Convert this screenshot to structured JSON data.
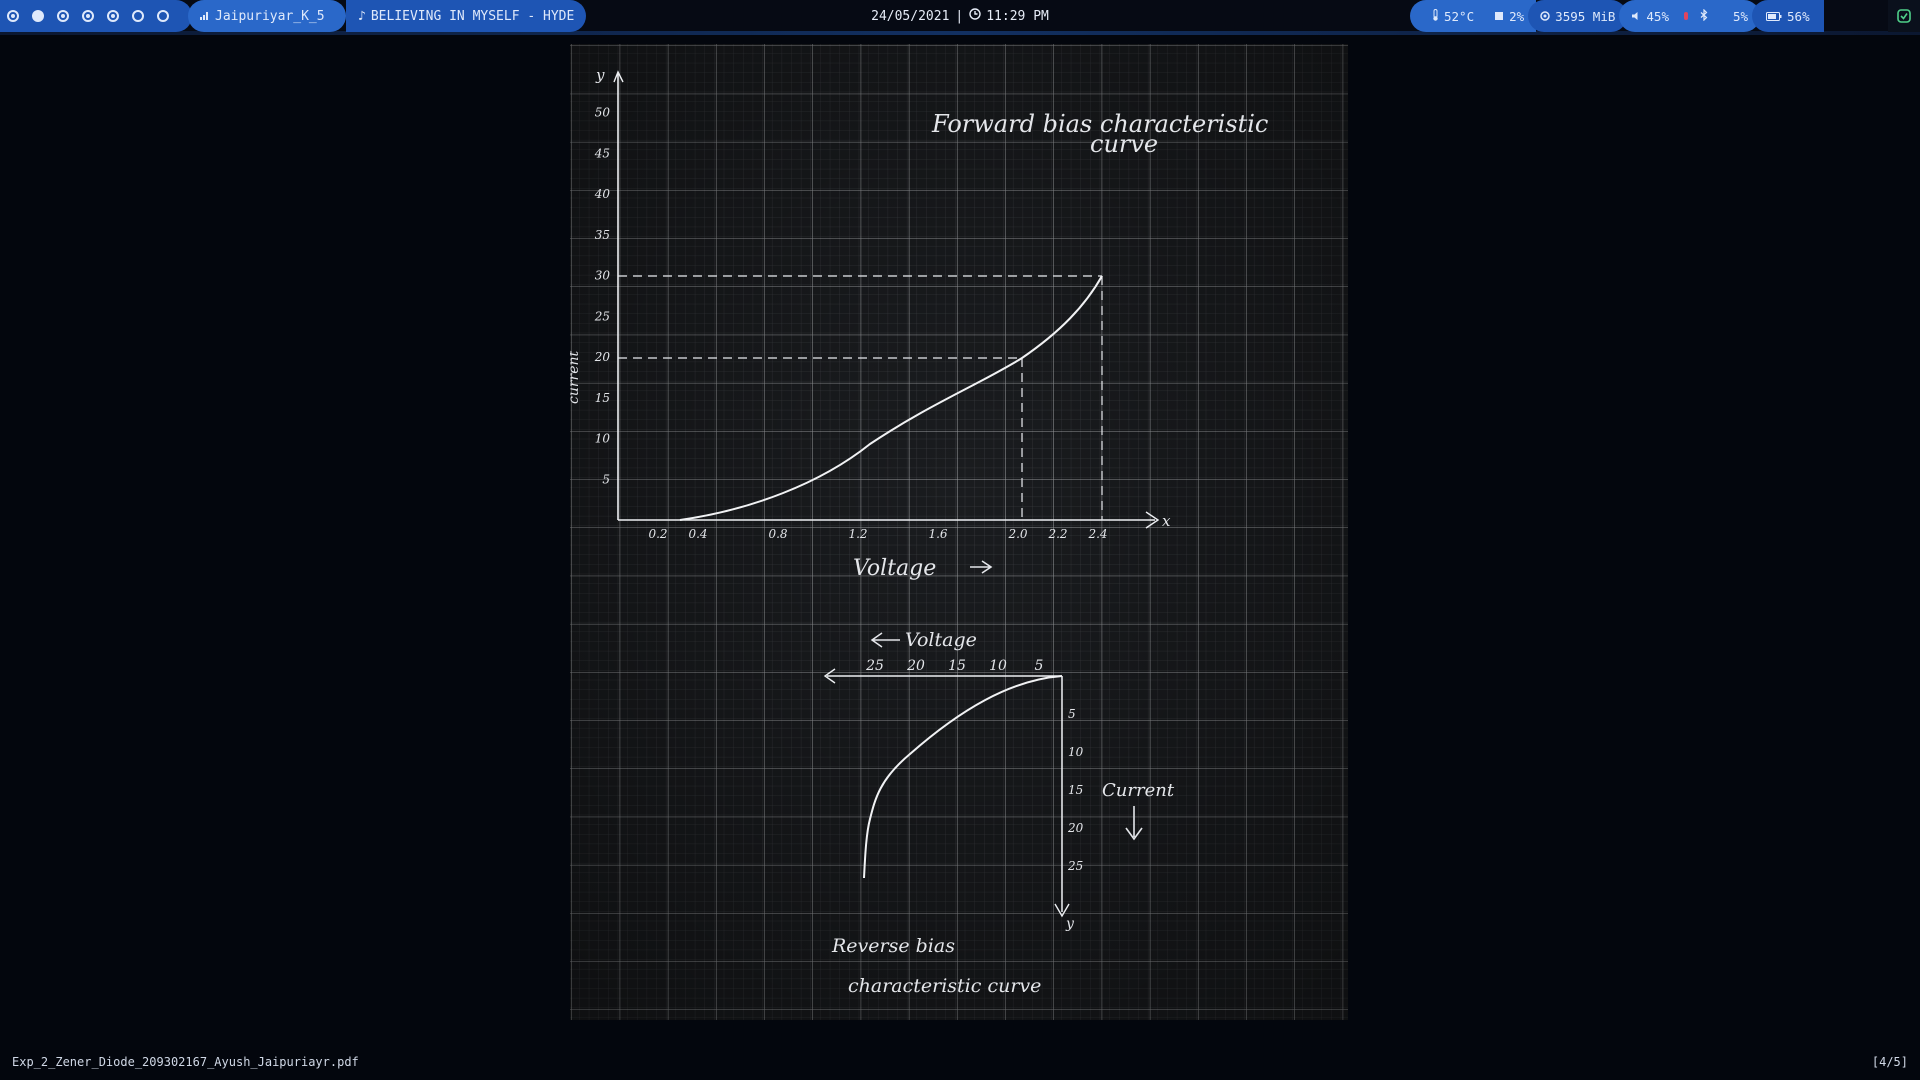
{
  "topbar": {
    "workspaces": [
      "filled",
      "filled",
      "active",
      "active",
      "active",
      "empty",
      "empty"
    ],
    "network": {
      "icon": "signal-icon",
      "label": "Jaipuriyar_K_5"
    },
    "music": {
      "icon": "music-note-icon",
      "label": "BELIEVING IN MYSELF - HYDE"
    },
    "date": "24/05/2021",
    "separator": "|",
    "time": "11:29 PM",
    "temperature": "52°C",
    "cpu": "2%",
    "memory": "3595 MiB",
    "volume": "45%",
    "brightness": "5%",
    "battery": "56%"
  },
  "document": {
    "title_line1": "Forward bias characteristic",
    "title_line2": "curve",
    "y_symbol": "y",
    "x_symbol": "x",
    "x_axis_label": "Voltage",
    "y_axis_label": "current",
    "y_ticks": [
      "5",
      "10",
      "15",
      "20",
      "25",
      "30",
      "35",
      "40",
      "45",
      "50"
    ],
    "x_ticks": [
      "0.2",
      "0.4",
      "0.8",
      "1.2",
      "1.6",
      "2.0",
      "2.2",
      "2.4"
    ],
    "reverse_voltage_label": "Voltage",
    "reverse_x_ticks": [
      "25",
      "20",
      "15",
      "10",
      "5"
    ],
    "reverse_y_ticks": [
      "5",
      "10",
      "15",
      "20",
      "25"
    ],
    "reverse_current_label": "Current",
    "reverse_caption_line1": "Reverse bias",
    "reverse_caption_line2": "characteristic curve"
  },
  "statusbar": {
    "filename": "Exp_2_Zener_Diode_209302167_Ayush_Jaipuriayr.pdf",
    "page": "[4/5]"
  }
}
